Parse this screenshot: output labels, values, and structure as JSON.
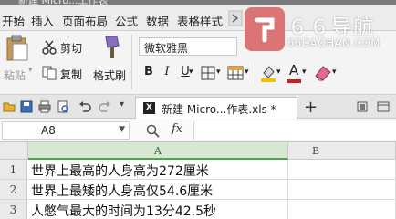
{
  "titlebar": {
    "title": "新建 Micro...工作表"
  },
  "menu": {
    "items": [
      "开始",
      "插入",
      "页面布局",
      "公式",
      "数据",
      "表格样式"
    ]
  },
  "watermark": {
    "brand": "６６导航",
    "url": "66DAOHAN.COM"
  },
  "ribbon": {
    "cut": "剪切",
    "paste": "粘贴",
    "copy": "复制",
    "format_painter": "格式刷",
    "font_name": "微软雅黑",
    "bold": "B",
    "italic": "I",
    "underline": "U",
    "font_color_letter": "A"
  },
  "doc_tab": {
    "title": "新建 Micro...作表.xls *"
  },
  "formula_bar": {
    "cell_ref": "A8",
    "fx": "fx",
    "content": ""
  },
  "sheet": {
    "columns": [
      "A",
      "B"
    ],
    "rows": [
      {
        "num": "1",
        "a": "世界上最高的人身高为272厘米"
      },
      {
        "num": "2",
        "a": "世界上最矮的人身高仅54.6厘米"
      },
      {
        "num": "3",
        "a": "人憋气最大的时间为13分42.5秒"
      }
    ]
  },
  "colors": {
    "accent": "#56a14f",
    "watermark_logo": "#d96b6b"
  }
}
